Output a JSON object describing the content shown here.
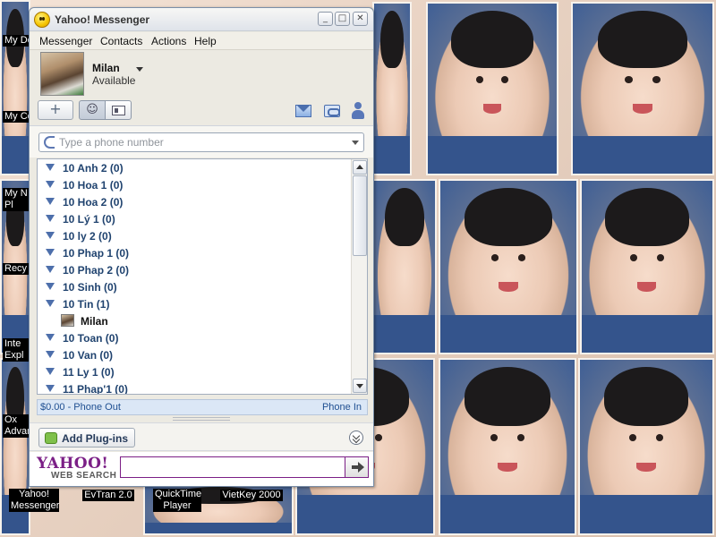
{
  "window": {
    "title": "Yahoo! Messenger",
    "min_label": "_",
    "max_label": "□",
    "close_label": "✕"
  },
  "menu": [
    "Messenger",
    "Contacts",
    "Actions",
    "Help"
  ],
  "profile": {
    "name": "Milan",
    "status": "Available"
  },
  "toolbar": {
    "add_label": "+",
    "contacts_view_glyph": "☺"
  },
  "phone": {
    "placeholder": "Type a phone number"
  },
  "contact_groups": [
    {
      "label": "10 Anh 2 (0)"
    },
    {
      "label": "10 Hoa 1 (0)"
    },
    {
      "label": "10 Hoa 2 (0)"
    },
    {
      "label": "10 Lý 1 (0)"
    },
    {
      "label": "10 ly 2 (0)"
    },
    {
      "label": "10 Phap 1 (0)"
    },
    {
      "label": "10 Phap 2 (0)"
    },
    {
      "label": "10 Sinh (0)"
    },
    {
      "label": "10 Tin (1)"
    },
    {
      "label": "10 Toan (0)"
    },
    {
      "label": "10 Van (0)"
    },
    {
      "label": "11 Ly 1 (0)"
    },
    {
      "label": "11 Phap'1 (0)"
    }
  ],
  "expanded_contact": {
    "name": "Milan"
  },
  "phone_bar": {
    "out": "$0.00 - Phone Out",
    "in": "Phone In"
  },
  "plugins": {
    "label": "Add Plug-ins"
  },
  "search": {
    "logo": "YAHOO!",
    "label": "WEB SEARCH",
    "value": ""
  },
  "desktop": {
    "icons": [
      {
        "label": "Yahoo! Messenger"
      },
      {
        "label": "EvTran 2.0"
      },
      {
        "label": "QuickTime Player"
      },
      {
        "label": "VietKey 2000"
      }
    ],
    "left_labels": [
      "My Do",
      "My Co",
      "My N Pl",
      "Recy",
      "Inte Expl",
      "Ox Advan"
    ]
  },
  "colors": {
    "accent": "#4d6fab",
    "yahoo_purple": "#7b1f86",
    "group_text": "#20436f"
  }
}
